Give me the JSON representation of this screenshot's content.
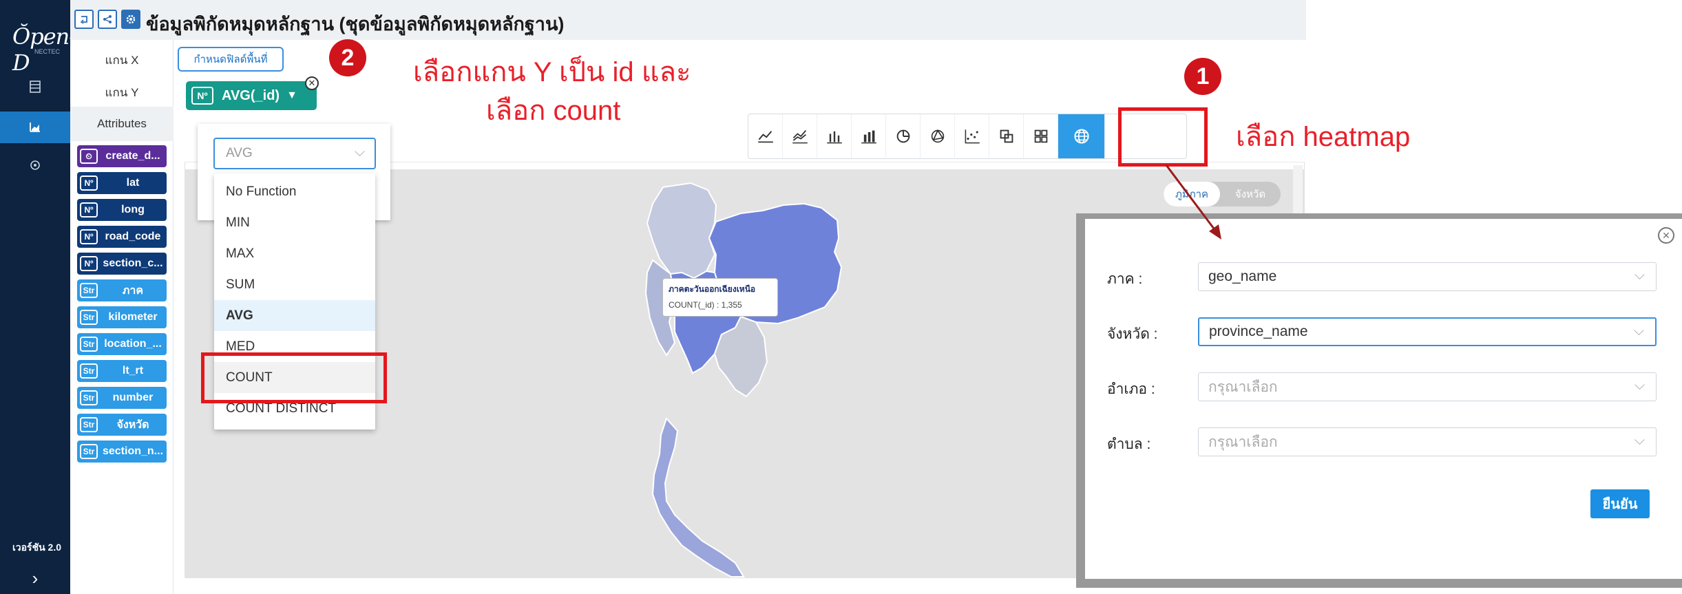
{
  "app": {
    "logo_text": "Ŏpen-D",
    "logo_sub": "NECTEC",
    "version": "เวอร์ชัน 2.0",
    "nav": [
      {
        "name": "dataset-icon"
      },
      {
        "name": "chart-icon",
        "active": true
      },
      {
        "name": "location-icon"
      }
    ],
    "expand_icon": "›"
  },
  "header": {
    "title": "ข้อมูลพิกัดหมุดหลักฐาน (ชุดข้อมูลพิกัดหมุดหลักฐาน)",
    "buttons": [
      "back-icon",
      "share-icon",
      "settings-icon"
    ]
  },
  "axes": {
    "x_label": "แกน X",
    "y_label": "แกน Y",
    "attributes_label": "Attributes",
    "x_field_button": "กำหนดฟิลด์พื้นที่",
    "y_chip": {
      "type": "Nº",
      "label": "AVG(_id)"
    }
  },
  "attributes": [
    {
      "type": "date",
      "tag": "⏲",
      "name": "create_d..."
    },
    {
      "type": "num",
      "tag": "Nº",
      "name": "lat"
    },
    {
      "type": "num",
      "tag": "Nº",
      "name": "long"
    },
    {
      "type": "num",
      "tag": "Nº",
      "name": "road_code"
    },
    {
      "type": "num",
      "tag": "Nº",
      "name": "section_c..."
    },
    {
      "type": "str",
      "tag": "Str",
      "name": "ภาค"
    },
    {
      "type": "str",
      "tag": "Str",
      "name": "kilometer"
    },
    {
      "type": "str",
      "tag": "Str",
      "name": "location_..."
    },
    {
      "type": "str",
      "tag": "Str",
      "name": "lt_rt"
    },
    {
      "type": "str",
      "tag": "Str",
      "name": "number"
    },
    {
      "type": "str",
      "tag": "Str",
      "name": "จังหวัด"
    },
    {
      "type": "str",
      "tag": "Str",
      "name": "section_n..."
    }
  ],
  "aggregation": {
    "selected": "AVG",
    "options": [
      "No Function",
      "MIN",
      "MAX",
      "SUM",
      "AVG",
      "MED",
      "COUNT",
      "COUNT DISTINCT"
    ],
    "hovered": "COUNT"
  },
  "chart_types": [
    "line-chart-icon",
    "multi-line-icon",
    "bar-chart-icon",
    "stacked-bar-icon",
    "pie-chart-icon",
    "radar-icon",
    "scatter-icon",
    "overlap-icon",
    "pivot-table-icon",
    "heatmap-globe-icon"
  ],
  "map": {
    "toggle_on": "ภูมิภาค",
    "toggle_off": "จังหวัด",
    "tooltip_region": "ภาคตะวันออกเฉียงเหนือ",
    "tooltip_value": "COUNT(_id) : 1,355",
    "colors": {
      "north": "#c3c9de",
      "northeast": "#6f82da",
      "central": "#6f82da",
      "east": "#c7cbd8",
      "west": "#aeb7d8",
      "south": "#9aa5db"
    }
  },
  "geo_modal": {
    "fields": [
      {
        "label": "ภาค :",
        "value": "geo_name",
        "placeholder": false
      },
      {
        "label": "จังหวัด :",
        "value": "province_name",
        "placeholder": false,
        "focus": true
      },
      {
        "label": "อำเภอ :",
        "value": "กรุณาเลือก",
        "placeholder": true
      },
      {
        "label": "ตำบล :",
        "value": "กรุณาเลือก",
        "placeholder": true
      }
    ],
    "confirm": "ยืนยัน"
  },
  "annotations": {
    "step1_number": "1",
    "step1_text": "เลือก heatmap",
    "step2_number": "2",
    "step2_text_line1": "เลือกแกน Y เป็น id และ",
    "step2_text_line2": "เลือก count",
    "color": "#e3171d"
  }
}
